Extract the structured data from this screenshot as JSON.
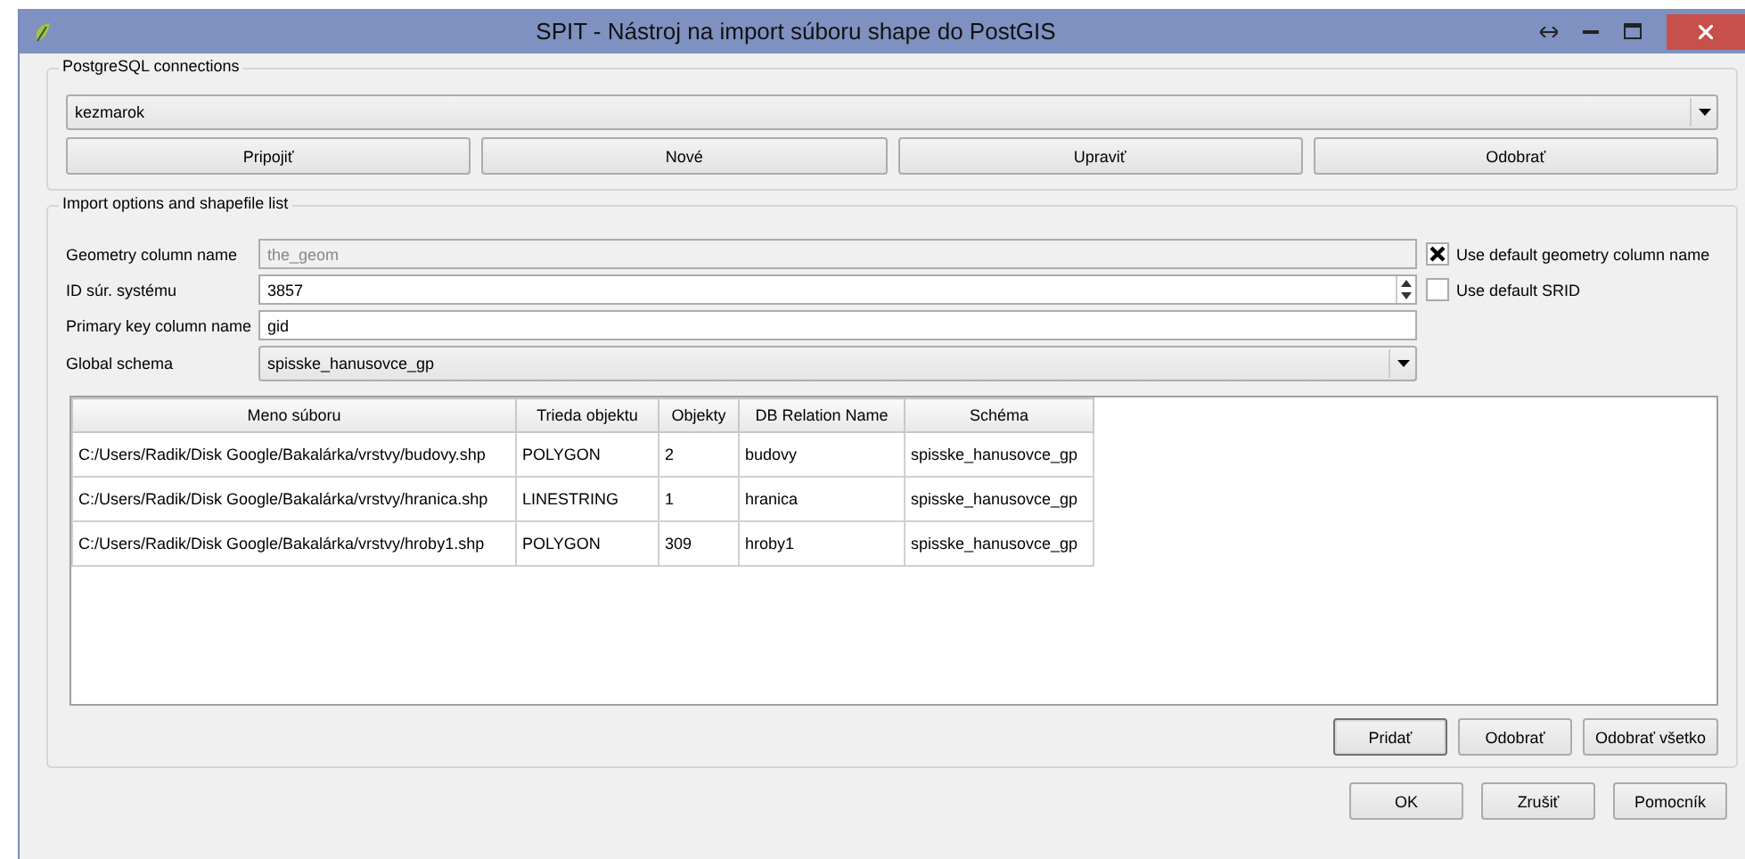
{
  "window": {
    "title": "SPIT - Nástroj na import súboru shape do PostGIS"
  },
  "connections": {
    "title": "PostgreSQL connections",
    "selected_connection": "kezmarok",
    "buttons": [
      "Pripojiť",
      "Nové",
      "Upraviť",
      "Odobrať"
    ]
  },
  "import_options": {
    "title": "Import options and shapefile list",
    "geometry_column": {
      "label": "Geometry column name",
      "value": "the_geom",
      "disabled": true,
      "checkbox": {
        "label": "Use default geometry column name",
        "checked": true
      }
    },
    "srid": {
      "label": "ID súr. systému",
      "value": "3857",
      "checkbox": {
        "label": "Use default SRID",
        "checked": false
      }
    },
    "primary_key": {
      "label": "Primary key column name",
      "value": "gid"
    },
    "global_schema": {
      "label": "Global schema",
      "value": "spisske_hanusovce_gp"
    },
    "table": {
      "columns": [
        "Meno súboru",
        "Trieda objektu",
        "Objekty",
        "DB Relation Name",
        "Schéma"
      ],
      "rows": [
        [
          "C:/Users/Radik/Disk Google/Bakalárka/vrstvy/budovy.shp",
          "POLYGON",
          "2",
          "budovy",
          "spisske_hanusovce_gp"
        ],
        [
          "C:/Users/Radik/Disk Google/Bakalárka/vrstvy/hranica.shp",
          "LINESTRING",
          "1",
          "hranica",
          "spisske_hanusovce_gp"
        ],
        [
          "C:/Users/Radik/Disk Google/Bakalárka/vrstvy/hroby1.shp",
          "POLYGON",
          "309",
          "hroby1",
          "spisske_hanusovce_gp"
        ]
      ]
    },
    "buttons": [
      {
        "label": "Pridať",
        "selected": true
      },
      {
        "label": "Odobrať",
        "selected": false
      },
      {
        "label": "Odobrať všetko",
        "selected": false
      }
    ]
  },
  "dialog_buttons": [
    "OK",
    "Zrušiť",
    "Pomocník"
  ]
}
